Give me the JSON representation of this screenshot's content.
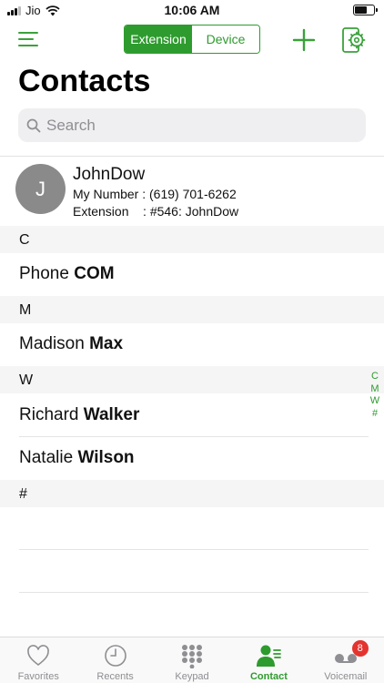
{
  "status_bar": {
    "carrier": "Jio",
    "time": "10:06 AM"
  },
  "toolbar": {
    "segments": [
      {
        "label": "Extension",
        "active": true
      },
      {
        "label": "Device",
        "active": false
      }
    ]
  },
  "page": {
    "title": "Contacts"
  },
  "search": {
    "placeholder": "Search"
  },
  "my_card": {
    "avatar_initial": "J",
    "name": "JohnDow",
    "my_number_line": "My Number : (619) 701-6262",
    "extension_line": "Extension    : #546: JohnDow"
  },
  "sections": [
    {
      "letter": "C",
      "contacts": [
        {
          "first": "Phone",
          "last": "COM"
        }
      ]
    },
    {
      "letter": "M",
      "contacts": [
        {
          "first": "Madison",
          "last": "Max"
        }
      ]
    },
    {
      "letter": "W",
      "contacts": [
        {
          "first": "Richard",
          "last": "Walker"
        },
        {
          "first": "Natalie",
          "last": "Wilson"
        }
      ]
    },
    {
      "letter": "#",
      "contacts": []
    }
  ],
  "index_bar": [
    "C",
    "M",
    "W",
    "#"
  ],
  "tabs": [
    {
      "label": "Favorites",
      "icon": "heart-icon",
      "active": false
    },
    {
      "label": "Recents",
      "icon": "clock-icon",
      "active": false
    },
    {
      "label": "Keypad",
      "icon": "keypad-icon",
      "active": false
    },
    {
      "label": "Contact",
      "icon": "contact-icon",
      "active": true
    },
    {
      "label": "Voicemail",
      "icon": "voicemail-icon",
      "active": false,
      "badge": "8"
    }
  ],
  "colors": {
    "accent": "#2e9b2e",
    "badge": "#e3342f",
    "avatar": "#8a8a8a"
  }
}
